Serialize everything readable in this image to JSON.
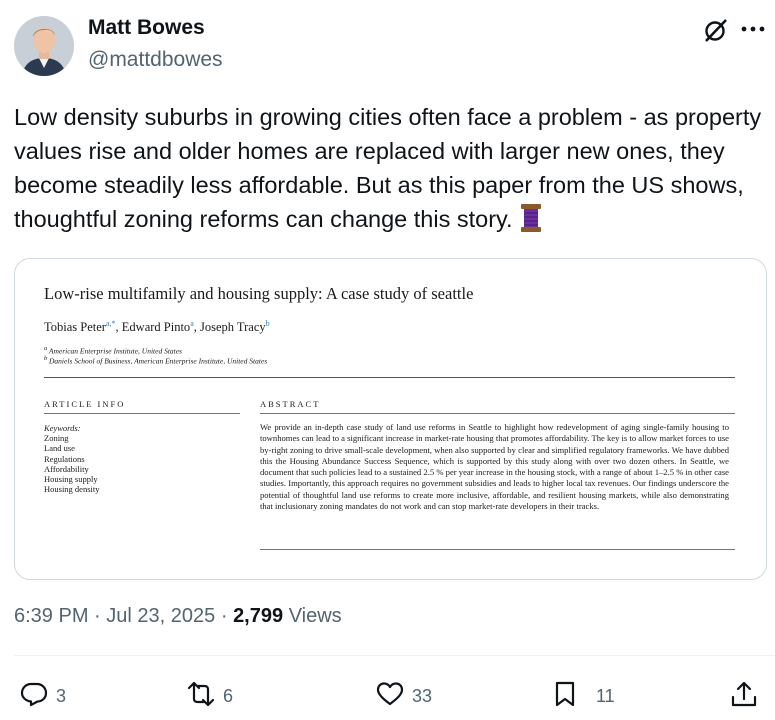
{
  "author": {
    "name": "Matt Bowes",
    "handle": "@mattdbowes"
  },
  "tweet": {
    "text": "Low density suburbs in growing cities often face a problem - as property values rise and older homes are replaced with larger new ones, they become steadily less affordable. But as this paper from the US shows, thoughtful zoning reforms can change this story."
  },
  "paper": {
    "title": "Low-rise multifamily and housing supply: A case study of seattle",
    "authors": [
      {
        "name": "Tobias Peter",
        "sup": "a,*"
      },
      {
        "name": "Edward Pinto",
        "sup": "a"
      },
      {
        "name": "Joseph Tracy",
        "sup": "b"
      }
    ],
    "affiliations": [
      {
        "mark": "a",
        "text": "American Enterprise Institute, United States"
      },
      {
        "mark": "b",
        "text": "Daniels School of Business, American Enterprise Institute, United States"
      }
    ],
    "article_info_heading": "ARTICLE INFO",
    "abstract_heading": "ABSTRACT",
    "keywords_label": "Keywords:",
    "keywords": [
      "Zoning",
      "Land use",
      "Regulations",
      "Affordability",
      "Housing supply",
      "Housing density"
    ],
    "abstract": "We provide an in-depth case study of land use reforms in Seattle to highlight how redevelopment of aging single-family housing to townhomes can lead to a significant increase in market-rate housing that promotes affordability. The key is to allow market forces to use by-right zoning to drive small-scale development, when also supported by clear and simplified regulatory frameworks. We have dubbed this the Housing Abundance Success Sequence, which is supported by this study along with over two dozen others. In Seattle, we document that such policies lead to a sustained 2.5 % per year increase in the housing stock, with a range of about 1–2.5 % in other case studies. Importantly, this approach requires no government subsidies and leads to higher local tax revenues. Our findings underscore the potential of thoughtful land use reforms to create more inclusive, affordable, and resilient housing markets, while also demonstrating that inclusionary zoning mandates do not work and can stop market-rate developers in their tracks."
  },
  "meta": {
    "time": "6:39 PM",
    "sep1": "·",
    "date": "Jul 23, 2025",
    "sep2": "·",
    "views_count": "2,799",
    "views_label": "Views"
  },
  "actions": {
    "replies": "3",
    "reposts": "6",
    "likes": "33",
    "bookmarks": "11"
  },
  "icons": [
    "grok-icon",
    "more-icon",
    "thread-emoji-icon",
    "reply-icon",
    "repost-icon",
    "like-icon",
    "bookmark-icon",
    "share-icon"
  ],
  "colors": {
    "text": "#0f1419",
    "secondary": "#536471",
    "border": "#cfd9de",
    "thread_purple": "#6b2fa0"
  }
}
